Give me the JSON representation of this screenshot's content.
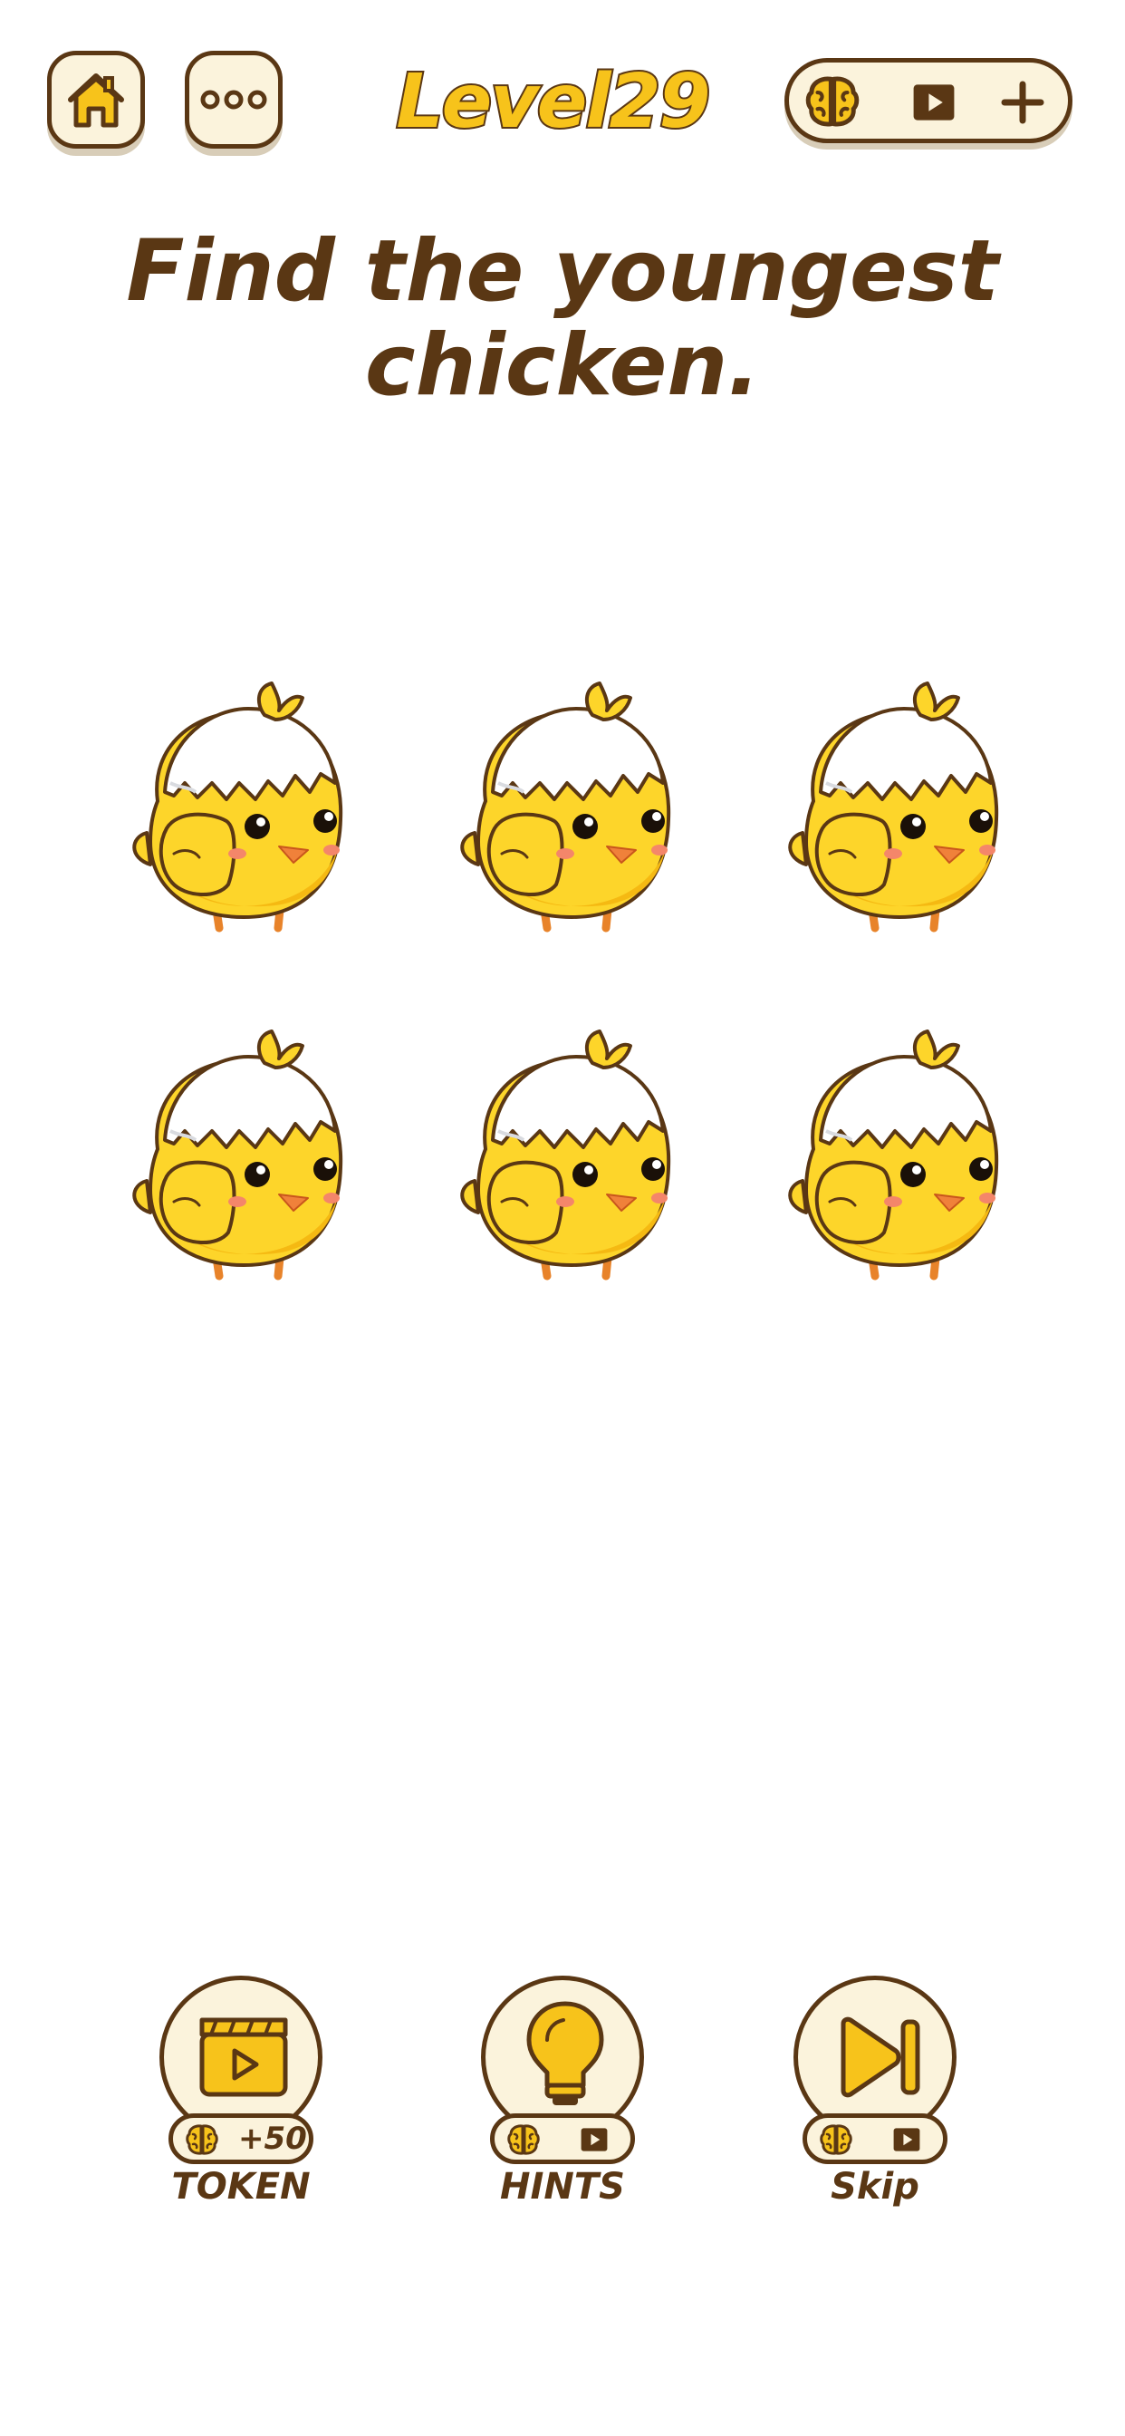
{
  "header": {
    "level_title": "Level29",
    "home_icon": "home-icon",
    "menu_icon": "more-dots-icon",
    "currency_icon": "brain-icon",
    "video_icon": "play-video-icon",
    "add_icon": "plus-icon"
  },
  "question": {
    "line1": "Find the youngest",
    "line2": "chicken."
  },
  "chickens": {
    "count": 6,
    "icon": "chick-in-eggshell"
  },
  "tools": {
    "token": {
      "label": "TOKEN",
      "reward": "+50",
      "icon": "video-clapper-icon"
    },
    "hints": {
      "label": "HINTS",
      "icon": "lightbulb-icon"
    },
    "skip": {
      "label": "Skip",
      "icon": "skip-forward-icon"
    }
  },
  "colors": {
    "brown": "#5a3714",
    "yellow": "#f7c31b",
    "cream": "#fbf3dc"
  }
}
